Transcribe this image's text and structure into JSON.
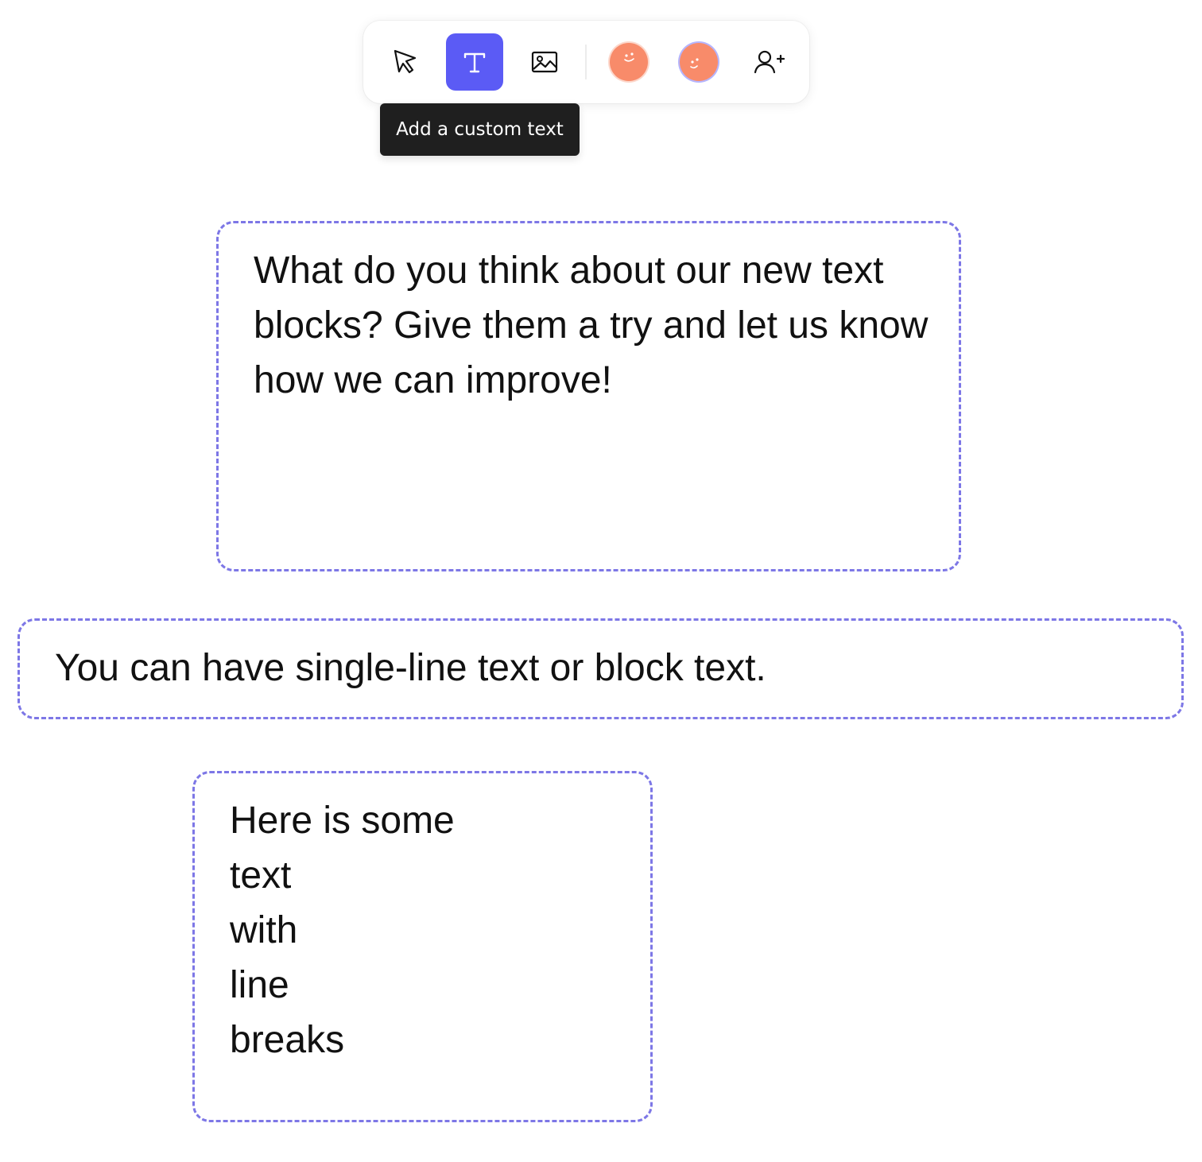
{
  "toolbar": {
    "tools": [
      {
        "name": "select",
        "icon": "cursor-icon",
        "active": false
      },
      {
        "name": "text",
        "icon": "text-t-icon",
        "active": true
      },
      {
        "name": "image",
        "icon": "image-icon",
        "active": false
      }
    ],
    "collaborators": [
      {
        "icon": "avatar",
        "color": "#f88b6a",
        "ring": "#fcd7cb"
      },
      {
        "icon": "avatar",
        "color": "#f88b6a",
        "ring": "#b5b5ff"
      }
    ],
    "invite_icon": "add-user-icon",
    "tooltip": "Add a custom text",
    "accent_color": "#5b5bf5"
  },
  "canvas": {
    "block_border_color": "#7d77e6",
    "blocks": [
      {
        "text": "What do you think about our new text blocks? Give them a try and let us know how we can improve!"
      },
      {
        "text": "You can have single-line text or block text."
      },
      {
        "text": "Here is some\ntext\nwith\nline\nbreaks"
      }
    ]
  }
}
